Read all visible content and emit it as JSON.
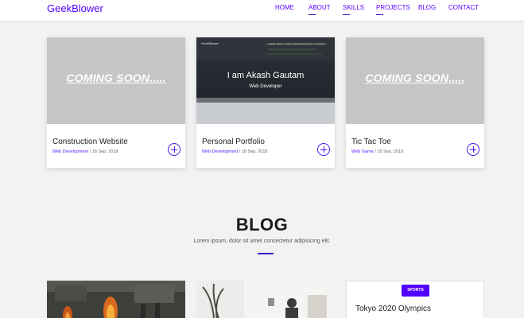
{
  "header": {
    "brand": "GeekBlower",
    "nav": [
      "HOME",
      "ABOUT",
      "SKILLS",
      "PROJECTS",
      "BLOG",
      "CONTACT"
    ]
  },
  "projects": [
    {
      "title": "Construction Website",
      "category": "Web Development",
      "date": " / 18 Sep. 2018",
      "image_text": "COMING SOON....."
    },
    {
      "title": "Personal Portfolio",
      "category": "Web Development",
      "date": " / 18 Sep. 2018",
      "image_text": "I am Akash Gautam",
      "image_subtext": "Web Developer"
    },
    {
      "title": "Tic Tac Toe",
      "category": "Web Game",
      "date": " / 18 Sep. 2018",
      "image_text": "COMING SOON....."
    }
  ],
  "blog": {
    "title": "BLOG",
    "subtitle": "Lorem ipsum, dolor sit amet consectetur adipisicing elit.",
    "posts": [
      {
        "badge": "SPORTS",
        "title": "Tokyo 2020 Olympics"
      }
    ]
  },
  "colors": {
    "accent": "#5200ff",
    "underline": "#2b0aa8"
  }
}
